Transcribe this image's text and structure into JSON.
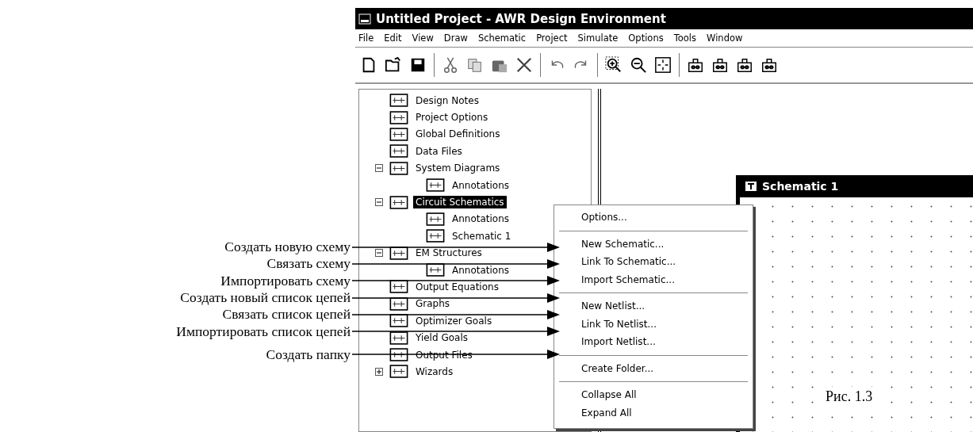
{
  "window": {
    "title": "Untitled Project - AWR Design Environment"
  },
  "menu_bar": [
    "File",
    "Edit",
    "View",
    "Draw",
    "Schematic",
    "Project",
    "Simulate",
    "Options",
    "Tools",
    "Window"
  ],
  "project_tree": [
    {
      "label": "Design Notes",
      "selected": false
    },
    {
      "label": "Project Options",
      "selected": false
    },
    {
      "label": "Global Definitions",
      "selected": false
    },
    {
      "label": "Data Files",
      "selected": false
    },
    {
      "label": "System Diagrams",
      "selected": false,
      "expanded": true,
      "children": [
        {
          "label": "Annotations",
          "selected": false
        }
      ]
    },
    {
      "label": "Circuit Schematics",
      "selected": true,
      "expanded": true,
      "children": [
        {
          "label": "Annotations",
          "selected": false
        },
        {
          "label": "Schematic 1",
          "selected": false
        }
      ]
    },
    {
      "label": "EM Structures",
      "selected": false,
      "expanded": true,
      "children": [
        {
          "label": "Annotations",
          "selected": false
        }
      ]
    },
    {
      "label": "Output Equations",
      "selected": false
    },
    {
      "label": "Graphs",
      "selected": false
    },
    {
      "label": "Optimizer Goals",
      "selected": false
    },
    {
      "label": "Yield Goals",
      "selected": false
    },
    {
      "label": "Output Files",
      "selected": false
    },
    {
      "label": "Wizards",
      "selected": false,
      "expanded": false
    }
  ],
  "schematic_window": {
    "title": "Schematic 1"
  },
  "context_menu": [
    [
      "Options..."
    ],
    [
      "New Schematic...",
      "Link To Schematic...",
      "Import Schematic..."
    ],
    [
      "New Netlist...",
      "Link To Netlist...",
      "Import Netlist..."
    ],
    [
      "Create Folder..."
    ],
    [
      "Collapse All",
      "Expand All"
    ]
  ],
  "callouts": [
    "Создать новую схему",
    "Связать схему",
    "Импортировать схему",
    "Создать новый список цепей",
    "Связать список цепей",
    "Импортировать список цепей",
    "Создать папку"
  ],
  "caption": "Рис. 1.3"
}
